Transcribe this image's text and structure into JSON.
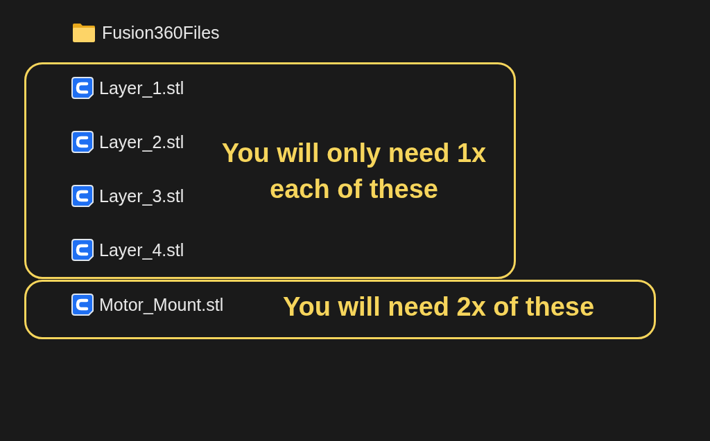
{
  "folder": {
    "name": "Fusion360Files"
  },
  "groups": [
    {
      "files": [
        {
          "name": "Layer_1.stl"
        },
        {
          "name": "Layer_2.stl"
        },
        {
          "name": "Layer_3.stl"
        },
        {
          "name": "Layer_4.stl"
        }
      ],
      "note": "You will only need 1x each of these"
    },
    {
      "files": [
        {
          "name": "Motor_Mount.stl"
        }
      ],
      "note": "You will need 2x of these"
    }
  ]
}
